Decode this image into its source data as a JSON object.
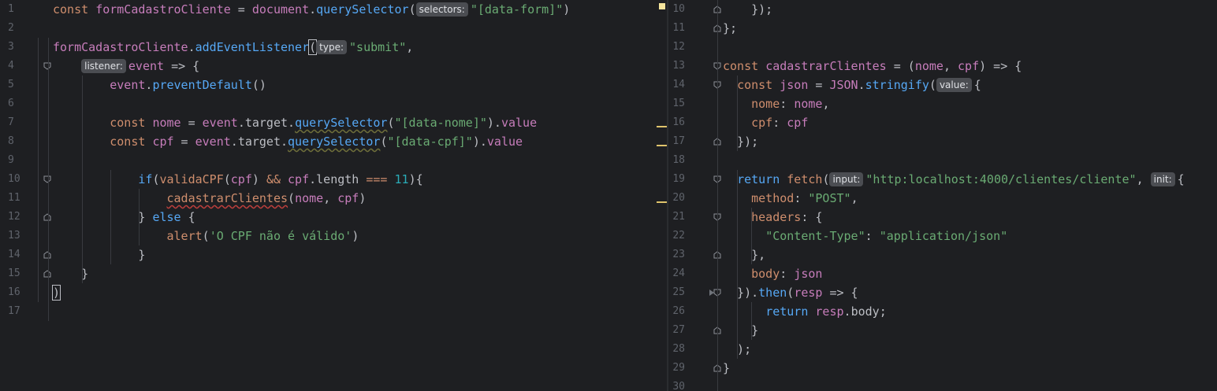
{
  "editor": {
    "left": {
      "line_numbers": [
        "1",
        "2",
        "3",
        "4",
        "5",
        "6",
        "7",
        "8",
        "9",
        "10",
        "11",
        "12",
        "13",
        "14",
        "15",
        "16",
        "17"
      ],
      "lines": [
        {
          "tokens": [
            [
              "kw",
              "const "
            ],
            [
              "purple",
              "formCadastroCliente"
            ],
            [
              "plain",
              " = "
            ],
            [
              "purple",
              "document"
            ],
            [
              "plain",
              "."
            ],
            [
              "fn",
              "querySelector"
            ],
            [
              "plain",
              "("
            ],
            [
              "hint",
              "selectors:"
            ],
            [
              "str",
              "\"[data-form]\""
            ],
            [
              "plain",
              ")"
            ]
          ]
        },
        {
          "tokens": []
        },
        {
          "tokens": [
            [
              "purple",
              "formCadastroCliente"
            ],
            [
              "plain",
              "."
            ],
            [
              "fn",
              "addEventListener"
            ],
            [
              "caret",
              "("
            ],
            [
              "hint",
              "type:"
            ],
            [
              "str",
              "\"submit\""
            ],
            [
              "plain",
              ","
            ]
          ]
        },
        {
          "tokens": [
            [
              "plain",
              "    "
            ],
            [
              "hint",
              "listener:"
            ],
            [
              "purple",
              "event"
            ],
            [
              "plain",
              " => {"
            ]
          ]
        },
        {
          "tokens": [
            [
              "plain",
              "        "
            ],
            [
              "purple",
              "event"
            ],
            [
              "plain",
              "."
            ],
            [
              "fn",
              "preventDefault"
            ],
            [
              "plain",
              "()"
            ]
          ]
        },
        {
          "tokens": []
        },
        {
          "tokens": [
            [
              "plain",
              "        "
            ],
            [
              "kw",
              "const "
            ],
            [
              "purple",
              "nome"
            ],
            [
              "plain",
              " = "
            ],
            [
              "purple",
              "event"
            ],
            [
              "plain",
              "."
            ],
            [
              "plain",
              "target"
            ],
            [
              "plain",
              "."
            ],
            [
              "squig",
              "querySelector"
            ],
            [
              "plain",
              "("
            ],
            [
              "str",
              "\"[data-nome]\""
            ],
            [
              "plain",
              ")."
            ],
            [
              "purple",
              "value"
            ]
          ]
        },
        {
          "tokens": [
            [
              "plain",
              "        "
            ],
            [
              "kw",
              "const "
            ],
            [
              "purple",
              "cpf"
            ],
            [
              "plain",
              " = "
            ],
            [
              "purple",
              "event"
            ],
            [
              "plain",
              "."
            ],
            [
              "plain",
              "target"
            ],
            [
              "plain",
              "."
            ],
            [
              "squig",
              "querySelector"
            ],
            [
              "plain",
              "("
            ],
            [
              "str",
              "\"[data-cpf]\""
            ],
            [
              "plain",
              ")."
            ],
            [
              "purple",
              "value"
            ]
          ]
        },
        {
          "tokens": []
        },
        {
          "tokens": [
            [
              "plain",
              "            "
            ],
            [
              "kw2",
              "if"
            ],
            [
              "plain",
              "("
            ],
            [
              "kw",
              "validaCPF"
            ],
            [
              "plain",
              "("
            ],
            [
              "purple",
              "cpf"
            ],
            [
              "plain",
              ") "
            ],
            [
              "kw",
              "&&"
            ],
            [
              "plain",
              " "
            ],
            [
              "purple",
              "cpf"
            ],
            [
              "plain",
              "."
            ],
            [
              "plain",
              "length"
            ],
            [
              "plain",
              " "
            ],
            [
              "kw",
              "==="
            ],
            [
              "plain",
              " "
            ],
            [
              "num",
              "11"
            ],
            [
              "plain",
              "){"
            ]
          ]
        },
        {
          "tokens": [
            [
              "plain",
              "                "
            ],
            [
              "squigred",
              "cadastrarClientes"
            ],
            [
              "plain",
              "("
            ],
            [
              "purple",
              "nome"
            ],
            [
              "plain",
              ", "
            ],
            [
              "purple",
              "cpf"
            ],
            [
              "plain",
              ")"
            ]
          ]
        },
        {
          "tokens": [
            [
              "plain",
              "            } "
            ],
            [
              "kw2",
              "else"
            ],
            [
              "plain",
              " {"
            ]
          ]
        },
        {
          "tokens": [
            [
              "plain",
              "                "
            ],
            [
              "kw",
              "alert"
            ],
            [
              "plain",
              "("
            ],
            [
              "str",
              "'O CPF não é válido'"
            ],
            [
              "plain",
              ")"
            ]
          ]
        },
        {
          "tokens": [
            [
              "plain",
              "            }"
            ]
          ]
        },
        {
          "tokens": [
            [
              "plain",
              "    }"
            ]
          ]
        },
        {
          "tokens": [
            [
              "caret",
              ")"
            ]
          ]
        },
        {
          "tokens": []
        }
      ]
    },
    "right": {
      "line_numbers": [
        "10",
        "11",
        "12",
        "13",
        "14",
        "15",
        "16",
        "17",
        "18",
        "19",
        "20",
        "21",
        "22",
        "23",
        "24",
        "25",
        "26",
        "27",
        "28",
        "29",
        "30"
      ],
      "lines": [
        {
          "tokens": [
            [
              "plain",
              "    });"
            ]
          ]
        },
        {
          "tokens": [
            [
              "plain",
              "};"
            ]
          ]
        },
        {
          "tokens": []
        },
        {
          "tokens": [
            [
              "kw",
              "const "
            ],
            [
              "purple",
              "cadastrarClientes"
            ],
            [
              "plain",
              " = ("
            ],
            [
              "purple",
              "nome"
            ],
            [
              "plain",
              ", "
            ],
            [
              "purple",
              "cpf"
            ],
            [
              "plain",
              ") => {"
            ]
          ]
        },
        {
          "tokens": [
            [
              "plain",
              "  "
            ],
            [
              "kw",
              "const "
            ],
            [
              "purple",
              "json"
            ],
            [
              "plain",
              " = "
            ],
            [
              "purple",
              "JSON"
            ],
            [
              "plain",
              "."
            ],
            [
              "fn",
              "stringify"
            ],
            [
              "plain",
              "("
            ],
            [
              "hint",
              "value:"
            ],
            [
              "plain",
              "{"
            ]
          ]
        },
        {
          "tokens": [
            [
              "plain",
              "    "
            ],
            [
              "kw",
              "nome"
            ],
            [
              "plain",
              ": "
            ],
            [
              "purple",
              "nome"
            ],
            [
              "plain",
              ","
            ]
          ]
        },
        {
          "tokens": [
            [
              "plain",
              "    "
            ],
            [
              "kw",
              "cpf"
            ],
            [
              "plain",
              ": "
            ],
            [
              "purple",
              "cpf"
            ]
          ]
        },
        {
          "tokens": [
            [
              "plain",
              "  });"
            ]
          ]
        },
        {
          "tokens": []
        },
        {
          "tokens": [
            [
              "plain",
              "  "
            ],
            [
              "kw2",
              "return "
            ],
            [
              "kw",
              "fetch"
            ],
            [
              "plain",
              "("
            ],
            [
              "hint",
              "input:"
            ],
            [
              "str",
              "\"http:localhost:4000/clientes/cliente\""
            ],
            [
              "plain",
              ", "
            ],
            [
              "hint",
              "init:"
            ],
            [
              "plain",
              "{"
            ]
          ]
        },
        {
          "tokens": [
            [
              "plain",
              "    "
            ],
            [
              "kw",
              "method"
            ],
            [
              "plain",
              ": "
            ],
            [
              "str",
              "\"POST\""
            ],
            [
              "plain",
              ","
            ]
          ]
        },
        {
          "tokens": [
            [
              "plain",
              "    "
            ],
            [
              "kw",
              "headers"
            ],
            [
              "plain",
              ": {"
            ]
          ]
        },
        {
          "tokens": [
            [
              "plain",
              "      "
            ],
            [
              "str",
              "\"Content-Type\""
            ],
            [
              "plain",
              ": "
            ],
            [
              "str",
              "\"application/json\""
            ]
          ]
        },
        {
          "tokens": [
            [
              "plain",
              "    },"
            ]
          ]
        },
        {
          "tokens": [
            [
              "plain",
              "    "
            ],
            [
              "kw",
              "body"
            ],
            [
              "plain",
              ": "
            ],
            [
              "purple",
              "json"
            ]
          ]
        },
        {
          "tokens": [
            [
              "plain",
              "  })."
            ],
            [
              "fn",
              "then"
            ],
            [
              "plain",
              "("
            ],
            [
              "purple",
              "resp"
            ],
            [
              "plain",
              " => {"
            ]
          ]
        },
        {
          "tokens": [
            [
              "plain",
              "      "
            ],
            [
              "kw2",
              "return "
            ],
            [
              "purple",
              "resp"
            ],
            [
              "plain",
              "."
            ],
            [
              "plain",
              "body"
            ],
            [
              "plain",
              ";"
            ]
          ]
        },
        {
          "tokens": [
            [
              "plain",
              "    }"
            ]
          ]
        },
        {
          "tokens": [
            [
              "plain",
              "  );"
            ]
          ]
        },
        {
          "tokens": [
            [
              "plain",
              "}"
            ]
          ]
        },
        {
          "tokens": []
        }
      ]
    },
    "colors": {
      "background": "#1e1f22",
      "keyword": "#cf8e6d",
      "function": "#56a8f5",
      "variable": "#c77dbb",
      "string": "#6aab73",
      "number": "#2aacb8",
      "hint_bg": "#4b4d52"
    },
    "icons": [
      "fold-open-icon",
      "fold-close-icon",
      "bookmark-icon",
      "breakpoint-arrow-icon"
    ]
  }
}
